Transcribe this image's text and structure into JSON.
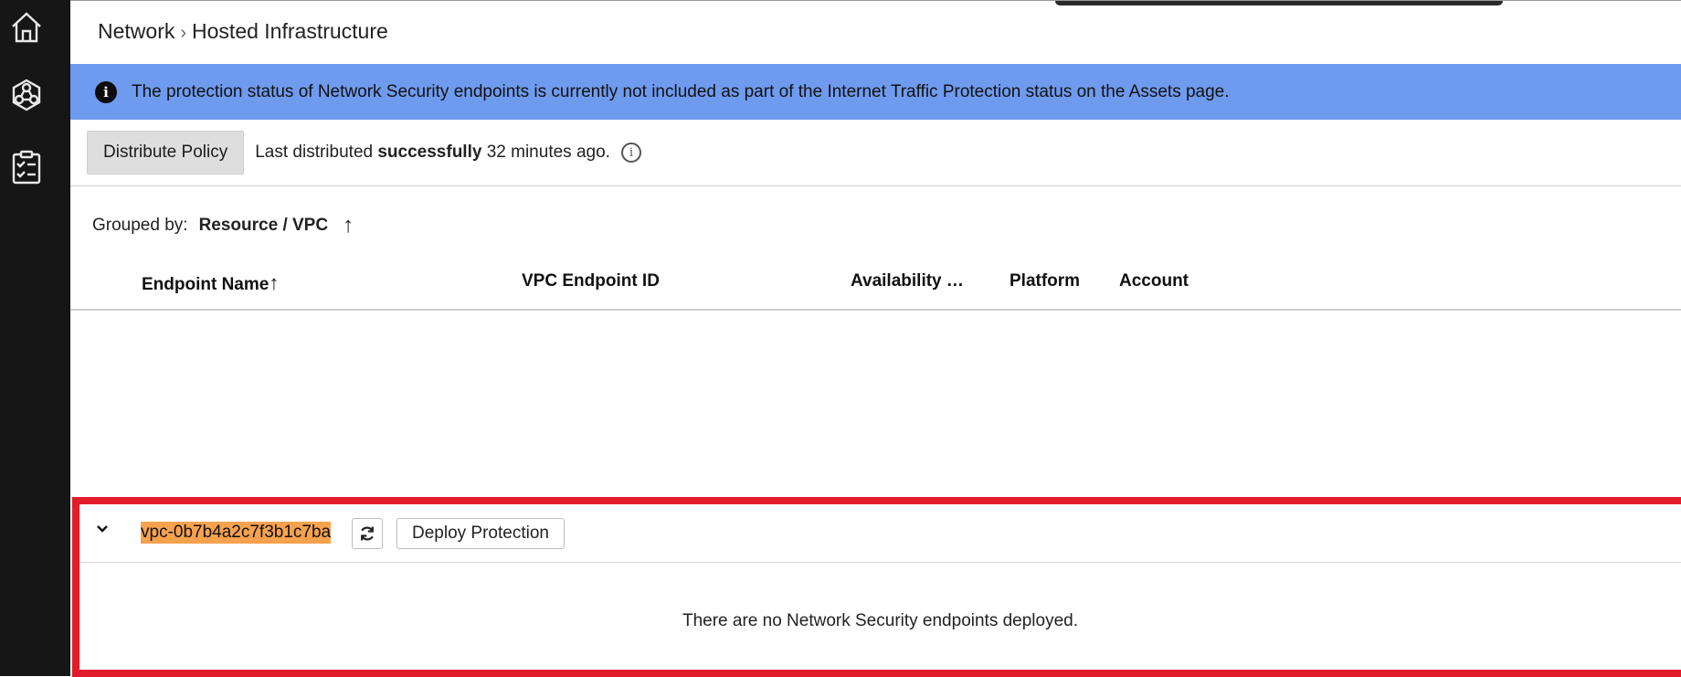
{
  "sidebar": {
    "icons": [
      "home-icon",
      "network-hexagon-icon",
      "checklist-icon"
    ]
  },
  "breadcrumb": {
    "parent": "Network",
    "separator": "›",
    "current": "Hosted Infrastructure"
  },
  "banner": {
    "text": "The protection status of Network Security endpoints is currently not included as part of the Internet Traffic Protection status on the Assets page.",
    "color": "#6f9bef"
  },
  "policy": {
    "button_label": "Distribute Policy",
    "status_prefix": "Last distributed",
    "status_bold": "successfully",
    "status_suffix": "32 minutes ago."
  },
  "grouping": {
    "label": "Grouped by:",
    "value": "Resource / VPC",
    "sort_arrow": "↑"
  },
  "table": {
    "columns": [
      "Endpoint Name",
      "VPC Endpoint ID",
      "Availability …",
      "Platform",
      "Account"
    ],
    "sort_arrow": "↑"
  },
  "group": {
    "vpc_id": "vpc-0b7b4a2c7f3b1c7ba",
    "deploy_label": "Deploy Protection",
    "empty_message": "There are no Network Security endpoints deployed.",
    "highlight_color": "#f7a24f",
    "outline_color": "#e21c2a"
  }
}
